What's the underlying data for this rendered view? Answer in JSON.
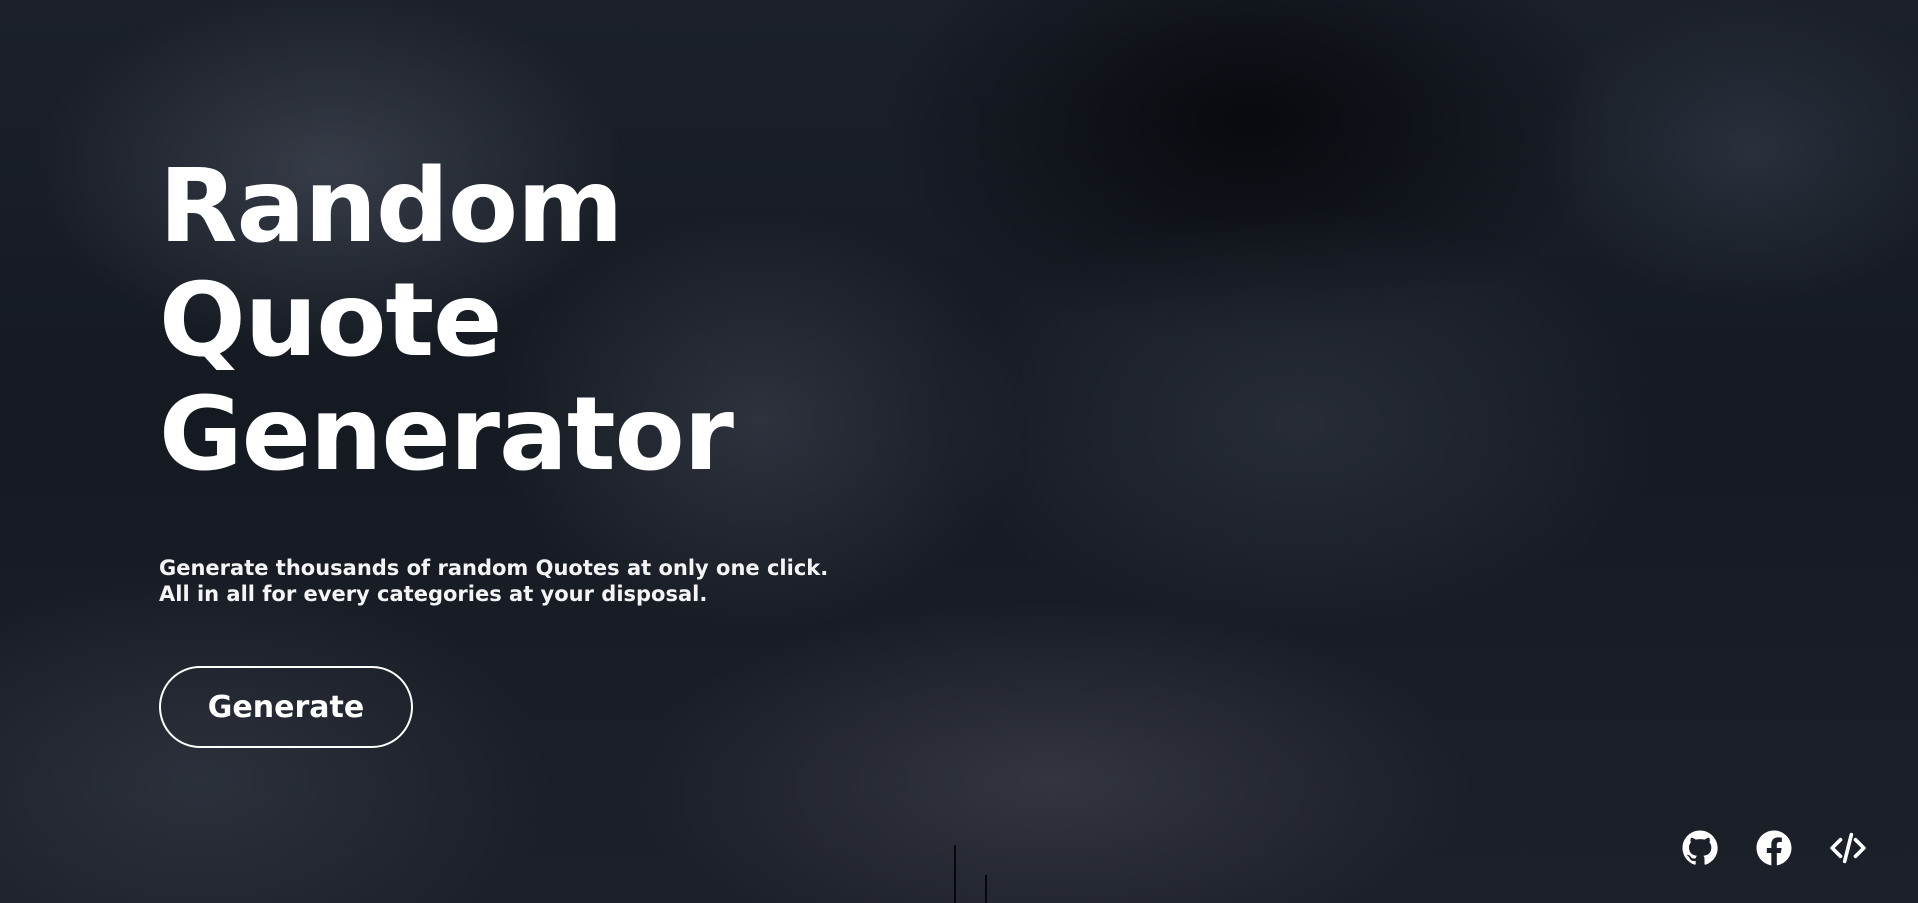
{
  "hero": {
    "title_lines": [
      "Random",
      "Quote",
      "Generator"
    ],
    "subtitle_lines": [
      "Generate thousands of random Quotes at only one click.",
      "All in all for every categories at your disposal."
    ],
    "button_label": "Generate"
  },
  "social_links": [
    {
      "icon": "github-icon",
      "label": "GitHub"
    },
    {
      "icon": "facebook-icon",
      "label": "Facebook"
    },
    {
      "icon": "code-icon",
      "label": "Source code"
    }
  ],
  "colors": {
    "text": "#ffffff",
    "background": "#161a22"
  }
}
